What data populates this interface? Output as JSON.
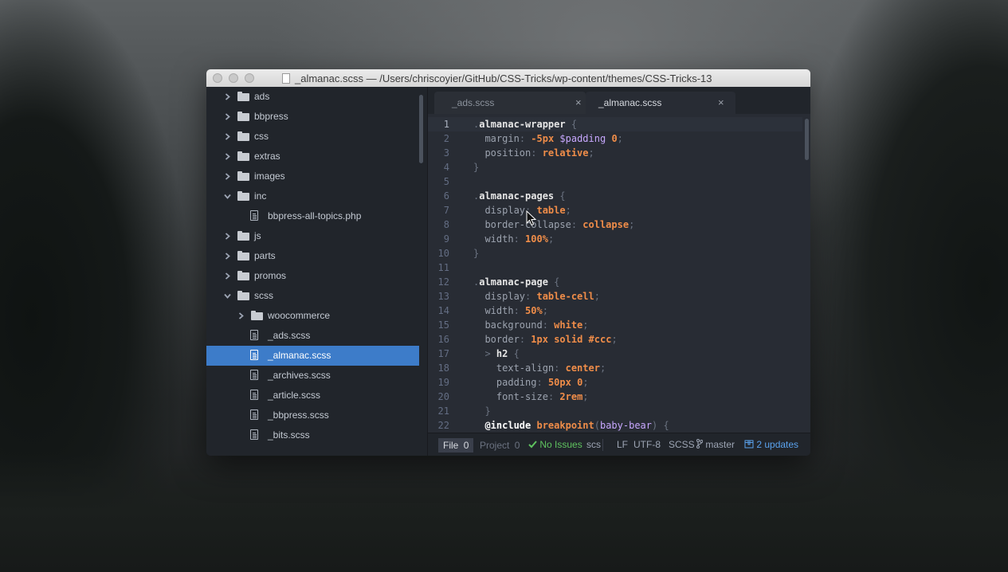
{
  "window": {
    "title": "_almanac.scss — /Users/chriscoyier/GitHub/CSS-Tricks/wp-content/themes/CSS-Tricks-13"
  },
  "tree": [
    {
      "label": "ads",
      "kind": "folder",
      "expanded": false,
      "depth": 0
    },
    {
      "label": "bbpress",
      "kind": "folder",
      "expanded": false,
      "depth": 0
    },
    {
      "label": "css",
      "kind": "folder",
      "expanded": false,
      "depth": 0
    },
    {
      "label": "extras",
      "kind": "folder",
      "expanded": false,
      "depth": 0
    },
    {
      "label": "images",
      "kind": "folder",
      "expanded": false,
      "depth": 0
    },
    {
      "label": "inc",
      "kind": "folder",
      "expanded": true,
      "depth": 0
    },
    {
      "label": "bbpress-all-topics.php",
      "kind": "file",
      "depth": 1
    },
    {
      "label": "js",
      "kind": "folder",
      "expanded": false,
      "depth": 0
    },
    {
      "label": "parts",
      "kind": "folder",
      "expanded": false,
      "depth": 0
    },
    {
      "label": "promos",
      "kind": "folder",
      "expanded": false,
      "depth": 0
    },
    {
      "label": "scss",
      "kind": "folder",
      "expanded": true,
      "depth": 0
    },
    {
      "label": "woocommerce",
      "kind": "folder",
      "expanded": false,
      "depth": 1
    },
    {
      "label": "_ads.scss",
      "kind": "file",
      "depth": 1
    },
    {
      "label": "_almanac.scss",
      "kind": "file",
      "depth": 1,
      "selected": true
    },
    {
      "label": "_archives.scss",
      "kind": "file",
      "depth": 1
    },
    {
      "label": "_article.scss",
      "kind": "file",
      "depth": 1
    },
    {
      "label": "_bbpress.scss",
      "kind": "file",
      "depth": 1
    },
    {
      "label": "_bits.scss",
      "kind": "file",
      "depth": 1
    }
  ],
  "tabs": [
    {
      "label": "_ads.scss",
      "active": false,
      "close": "×"
    },
    {
      "label": "_almanac.scss",
      "active": true,
      "close": "×"
    }
  ],
  "code": [
    {
      "n": "1",
      "cursor": true,
      "tokens": [
        [
          "sel-dot",
          "."
        ],
        [
          "sel",
          "almanac-wrapper"
        ],
        [
          "p",
          " {"
        ]
      ]
    },
    {
      "n": "2",
      "tokens": [
        [
          "p",
          "  "
        ],
        [
          "prop",
          "margin"
        ],
        [
          "p",
          ": "
        ],
        [
          "num",
          "-5px"
        ],
        [
          "p",
          " "
        ],
        [
          "var",
          "$padding"
        ],
        [
          "p",
          " "
        ],
        [
          "num",
          "0"
        ],
        [
          "p",
          ";"
        ]
      ]
    },
    {
      "n": "3",
      "tokens": [
        [
          "p",
          "  "
        ],
        [
          "prop",
          "position"
        ],
        [
          "p",
          ": "
        ],
        [
          "val",
          "relative"
        ],
        [
          "p",
          ";"
        ]
      ]
    },
    {
      "n": "4",
      "tokens": [
        [
          "p",
          "}"
        ]
      ]
    },
    {
      "n": "5",
      "tokens": []
    },
    {
      "n": "6",
      "tokens": [
        [
          "sel-dot",
          "."
        ],
        [
          "sel",
          "almanac-pages"
        ],
        [
          "p",
          " {"
        ]
      ]
    },
    {
      "n": "7",
      "tokens": [
        [
          "p",
          "  "
        ],
        [
          "prop",
          "display"
        ],
        [
          "p",
          ": "
        ],
        [
          "val",
          "table"
        ],
        [
          "p",
          ";"
        ]
      ]
    },
    {
      "n": "8",
      "tokens": [
        [
          "p",
          "  "
        ],
        [
          "prop",
          "border-collapse"
        ],
        [
          "p",
          ": "
        ],
        [
          "val",
          "collapse"
        ],
        [
          "p",
          ";"
        ]
      ]
    },
    {
      "n": "9",
      "tokens": [
        [
          "p",
          "  "
        ],
        [
          "prop",
          "width"
        ],
        [
          "p",
          ": "
        ],
        [
          "num",
          "100%"
        ],
        [
          "p",
          ";"
        ]
      ]
    },
    {
      "n": "10",
      "tokens": [
        [
          "p",
          "}"
        ]
      ]
    },
    {
      "n": "11",
      "tokens": []
    },
    {
      "n": "12",
      "tokens": [
        [
          "sel-dot",
          "."
        ],
        [
          "sel",
          "almanac-page"
        ],
        [
          "p",
          " {"
        ]
      ]
    },
    {
      "n": "13",
      "tokens": [
        [
          "p",
          "  "
        ],
        [
          "prop",
          "display"
        ],
        [
          "p",
          ": "
        ],
        [
          "val",
          "table-cell"
        ],
        [
          "p",
          ";"
        ]
      ]
    },
    {
      "n": "14",
      "tokens": [
        [
          "p",
          "  "
        ],
        [
          "prop",
          "width"
        ],
        [
          "p",
          ": "
        ],
        [
          "num",
          "50%"
        ],
        [
          "p",
          ";"
        ]
      ]
    },
    {
      "n": "15",
      "tokens": [
        [
          "p",
          "  "
        ],
        [
          "prop",
          "background"
        ],
        [
          "p",
          ": "
        ],
        [
          "val",
          "white"
        ],
        [
          "p",
          ";"
        ]
      ]
    },
    {
      "n": "16",
      "tokens": [
        [
          "p",
          "  "
        ],
        [
          "prop",
          "border"
        ],
        [
          "p",
          ": "
        ],
        [
          "num",
          "1px"
        ],
        [
          "p",
          " "
        ],
        [
          "val",
          "solid"
        ],
        [
          "p",
          " "
        ],
        [
          "val",
          "#ccc"
        ],
        [
          "p",
          ";"
        ]
      ]
    },
    {
      "n": "17",
      "tokens": [
        [
          "p",
          "  > "
        ],
        [
          "sel",
          "h2"
        ],
        [
          "p",
          " {"
        ]
      ]
    },
    {
      "n": "18",
      "tokens": [
        [
          "p",
          "    "
        ],
        [
          "prop",
          "text-align"
        ],
        [
          "p",
          ": "
        ],
        [
          "val",
          "center"
        ],
        [
          "p",
          ";"
        ]
      ]
    },
    {
      "n": "19",
      "tokens": [
        [
          "p",
          "    "
        ],
        [
          "prop",
          "padding"
        ],
        [
          "p",
          ": "
        ],
        [
          "num",
          "50px"
        ],
        [
          "p",
          " "
        ],
        [
          "num",
          "0"
        ],
        [
          "p",
          ";"
        ]
      ]
    },
    {
      "n": "20",
      "tokens": [
        [
          "p",
          "    "
        ],
        [
          "prop",
          "font-size"
        ],
        [
          "p",
          ": "
        ],
        [
          "num",
          "2rem"
        ],
        [
          "p",
          ";"
        ]
      ]
    },
    {
      "n": "21",
      "tokens": [
        [
          "p",
          "  }"
        ]
      ]
    },
    {
      "n": "22",
      "tokens": [
        [
          "p",
          "  "
        ],
        [
          "kw",
          "@include"
        ],
        [
          "p",
          " "
        ],
        [
          "fn",
          "breakpoint"
        ],
        [
          "p",
          "("
        ],
        [
          "var",
          "baby-bear"
        ],
        [
          "p",
          ") {"
        ]
      ]
    }
  ],
  "status": {
    "file_label": "File",
    "file_count": "0",
    "project_label": "Project",
    "project_count": "0",
    "issues": "No Issues",
    "scope": "scs",
    "line_ending": "LF",
    "encoding": "UTF-8",
    "grammar": "SCSS",
    "branch": "master",
    "updates": "2 updates"
  },
  "colors": {
    "selection": "#3d7cc9",
    "sel": "#e6e6e6",
    "prop": "#9ca3af",
    "num": "#f08d49",
    "val": "#f08d49",
    "var": "#c8a8ff",
    "kw": "#ffffff",
    "fn": "#f08d49",
    "punct": "#6a7280",
    "ok": "#5fc35f",
    "link": "#5aa2ee"
  },
  "icons": {
    "close": "close-icon",
    "folder": "folder-icon",
    "file": "file-icon",
    "chevron_right": "chevron-right-icon",
    "chevron_down": "chevron-down-icon",
    "check": "check-icon",
    "branch": "branch-icon",
    "package": "package-icon",
    "cursor": "cursor-icon"
  }
}
